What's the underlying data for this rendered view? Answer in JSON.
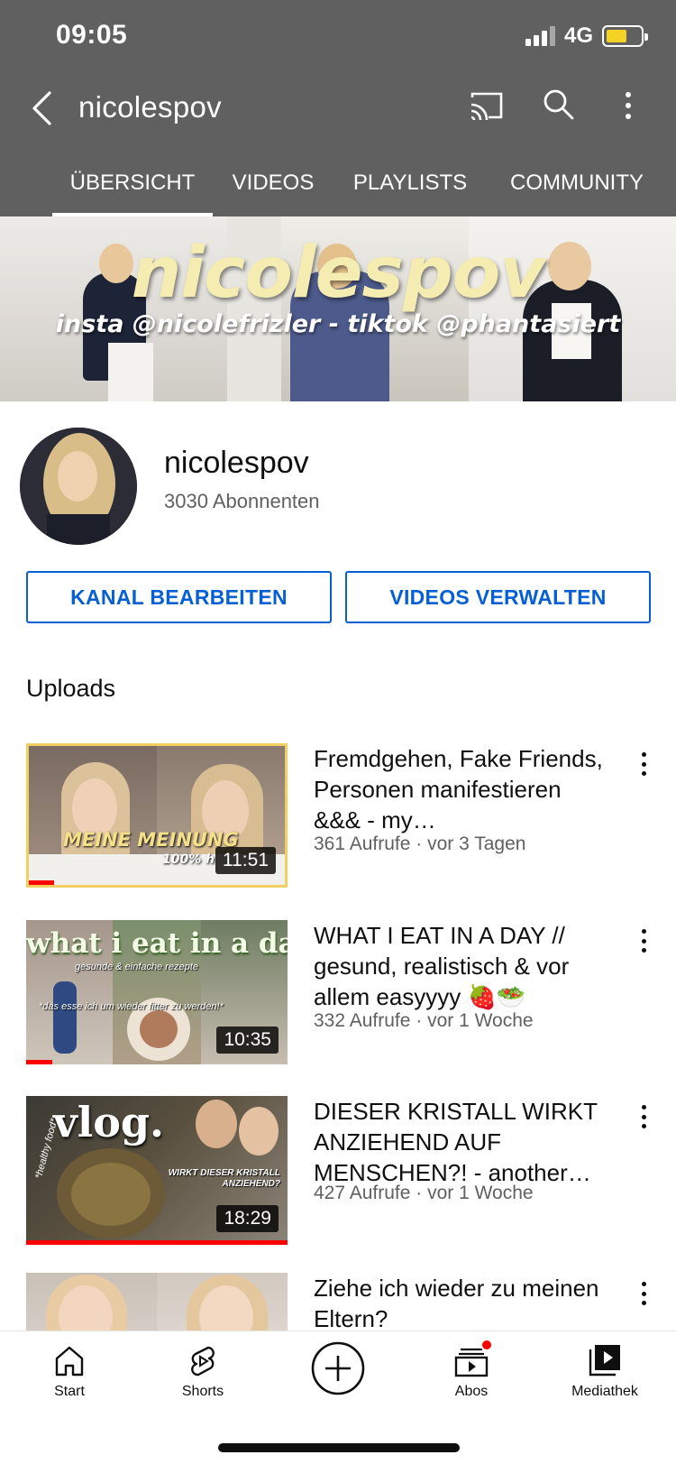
{
  "status_bar": {
    "time": "09:05",
    "network": "4G"
  },
  "header": {
    "title": "nicolespov"
  },
  "tabs": [
    {
      "label": "ÜBERSICHT",
      "active": true
    },
    {
      "label": "VIDEOS",
      "active": false
    },
    {
      "label": "PLAYLISTS",
      "active": false
    },
    {
      "label": "COMMUNITY",
      "active": false
    }
  ],
  "banner": {
    "title": "nicolespov",
    "subtitle": "insta @nicolefrizler - tiktok @phantasiert"
  },
  "channel": {
    "name": "nicolespov",
    "subscribers": "3030 Abonnenten"
  },
  "actions": {
    "edit_label": "KANAL BEARBEITEN",
    "manage_label": "VIDEOS VERWALTEN"
  },
  "uploads": {
    "heading": "Uploads",
    "videos": [
      {
        "title": "Fremdgehen, Fake Friends, Personen manifestieren &&& - my…",
        "meta": "361 Aufrufe · vor 3 Tagen",
        "duration": "11:51",
        "thumb_text": "MEINE MEINUNG",
        "thumb_text2": "100% h",
        "watched_fraction": 0.1
      },
      {
        "title": "WHAT I EAT IN A DAY // gesund, realistisch & vor allem easyyyy 🍓🥗",
        "meta": "332 Aufrufe · vor 1 Woche",
        "duration": "10:35",
        "thumb_text": "what i eat in a day",
        "thumb_text2": "gesunde & einfache rezepte",
        "thumb_text3": "*das esse ich um wieder fitter zu werden!*",
        "watched_fraction": 0.1
      },
      {
        "title": "DIESER KRISTALL WIRKT ANZIEHEND AUF MENSCHEN?! - another…",
        "meta": "427 Aufrufe · vor 1 Woche",
        "duration": "18:29",
        "thumb_text": "vlog.",
        "thumb_text2": "WIRKT DIESER KRISTALL ANZIEHEND?",
        "thumb_text3": "*healthy food*",
        "watched_fraction": 1.0
      },
      {
        "title": "Ziehe ich wieder zu meinen Eltern?",
        "meta": "",
        "duration": "",
        "watched_fraction": 0
      }
    ]
  },
  "bottom_nav": [
    {
      "label": "Start",
      "icon": "home-icon"
    },
    {
      "label": "Shorts",
      "icon": "shorts-icon"
    },
    {
      "label": "",
      "icon": "create-icon"
    },
    {
      "label": "Abos",
      "icon": "subscriptions-icon"
    },
    {
      "label": "Mediathek",
      "icon": "library-icon"
    }
  ],
  "colors": {
    "header_bg": "#606060",
    "accent_blue": "#065fd4",
    "progress_red": "#ff0000",
    "battery_yellow": "#f5d324"
  }
}
